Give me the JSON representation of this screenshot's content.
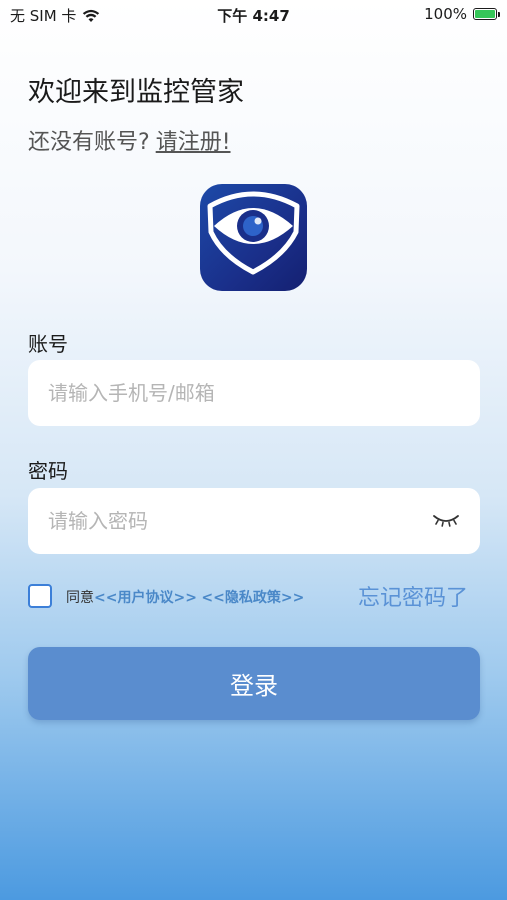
{
  "status_bar": {
    "carrier": "无 SIM 卡",
    "time": "下午 4:47",
    "battery_pct": "100%"
  },
  "welcome": "欢迎来到监控管家",
  "register": {
    "prompt": "还没有账号?",
    "link": "请注册!"
  },
  "account": {
    "label": "账号",
    "placeholder": "请输入手机号/邮箱"
  },
  "password": {
    "label": "密码",
    "placeholder": "请输入密码"
  },
  "agreement": {
    "prefix": "同意",
    "user_agreement": "<<用户协议>>",
    "privacy_policy": "<<隐私政策>>",
    "checked": false
  },
  "forgot_password": "忘记密码了",
  "login_button": "登录",
  "colors": {
    "primary": "#5a8dcf",
    "link": "#5a92d6",
    "logo_bg": "#1a2f8a"
  }
}
